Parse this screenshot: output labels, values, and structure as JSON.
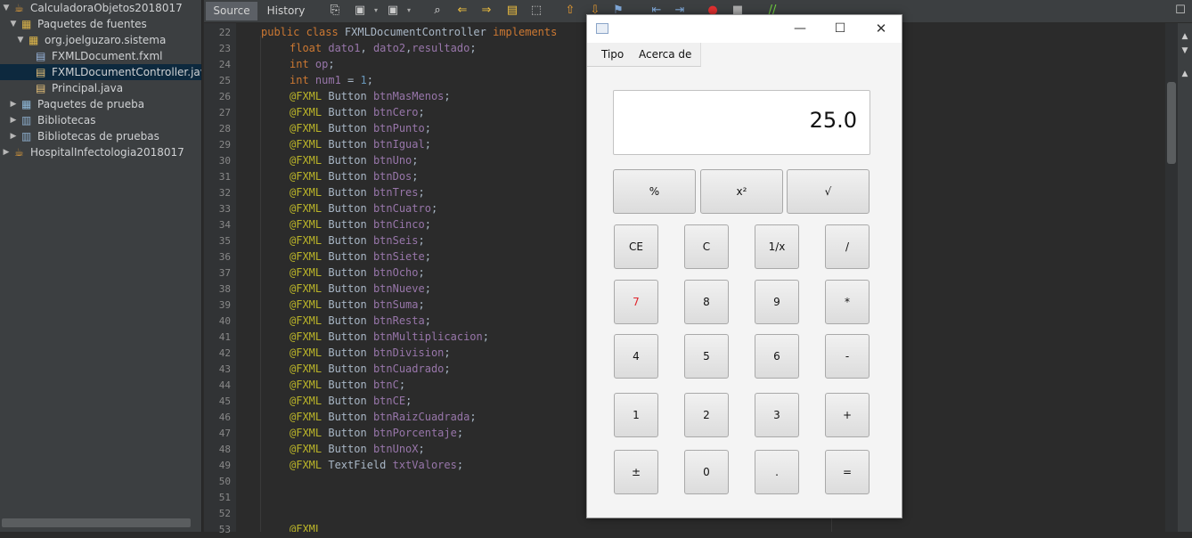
{
  "project": {
    "items": [
      {
        "label": "CalculadoraObjetos2018017",
        "arrow": "▼",
        "icon": "java-project-icon",
        "selected": false
      },
      {
        "label": "Paquetes de fuentes",
        "arrow": "▼",
        "icon": "source-packages-icon",
        "selected": false
      },
      {
        "label": "org.joelguzaro.sistema",
        "arrow": "▼",
        "icon": "package-icon",
        "selected": false
      },
      {
        "label": "FXMLDocument.fxml",
        "arrow": "",
        "icon": "fxml-file-icon",
        "selected": false
      },
      {
        "label": "FXMLDocumentController.jav",
        "arrow": "",
        "icon": "java-file-icon",
        "selected": true
      },
      {
        "label": "Principal.java",
        "arrow": "",
        "icon": "java-file-icon",
        "selected": false
      },
      {
        "label": "Paquetes de prueba",
        "arrow": "▶",
        "icon": "test-packages-icon",
        "selected": false
      },
      {
        "label": "Bibliotecas",
        "arrow": "▶",
        "icon": "libraries-icon",
        "selected": false
      },
      {
        "label": "Bibliotecas de pruebas",
        "arrow": "▶",
        "icon": "libraries-icon",
        "selected": false
      },
      {
        "label": "HospitalInfectologia2018017",
        "arrow": "▶",
        "icon": "java-project-icon",
        "selected": false
      }
    ]
  },
  "toolbar": {
    "source_tab": "Source",
    "history_tab": "History"
  },
  "editor": {
    "lines": [
      {
        "n": "22",
        "tokens": [
          [
            "kw",
            "public class "
          ],
          [
            "",
            "FXMLDocumentController "
          ],
          [
            "kw",
            "implements"
          ]
        ]
      },
      {
        "n": "23",
        "tokens": [
          [
            "kw",
            "float "
          ],
          [
            "field",
            "dato1"
          ],
          [
            "",
            ", "
          ],
          [
            "field",
            "dato2"
          ],
          [
            "",
            ","
          ],
          [
            "field",
            "resultado"
          ],
          [
            "",
            ";"
          ]
        ]
      },
      {
        "n": "24",
        "tokens": [
          [
            "kw",
            "int "
          ],
          [
            "field",
            "op"
          ],
          [
            "",
            ";"
          ]
        ]
      },
      {
        "n": "25",
        "tokens": [
          [
            "kw",
            "int "
          ],
          [
            "field",
            "num1"
          ],
          [
            "",
            " = "
          ],
          [
            "num",
            "1"
          ],
          [
            "",
            ";"
          ]
        ]
      },
      {
        "n": "26",
        "tokens": [
          [
            "ann",
            "@FXML "
          ],
          [
            "",
            "Button "
          ],
          [
            "field",
            "btnMasMenos"
          ],
          [
            "",
            ";"
          ]
        ]
      },
      {
        "n": "27",
        "tokens": [
          [
            "ann",
            "@FXML "
          ],
          [
            "",
            "Button "
          ],
          [
            "field",
            "btnCero"
          ],
          [
            "",
            ";"
          ]
        ]
      },
      {
        "n": "28",
        "tokens": [
          [
            "ann",
            "@FXML "
          ],
          [
            "",
            "Button "
          ],
          [
            "field",
            "btnPunto"
          ],
          [
            "",
            ";"
          ]
        ]
      },
      {
        "n": "29",
        "tokens": [
          [
            "ann",
            "@FXML "
          ],
          [
            "",
            "Button "
          ],
          [
            "field",
            "btnIgual"
          ],
          [
            "",
            ";"
          ]
        ]
      },
      {
        "n": "30",
        "tokens": [
          [
            "ann",
            "@FXML "
          ],
          [
            "",
            "Button "
          ],
          [
            "field",
            "btnUno"
          ],
          [
            "",
            ";"
          ]
        ]
      },
      {
        "n": "31",
        "tokens": [
          [
            "ann",
            "@FXML "
          ],
          [
            "",
            "Button "
          ],
          [
            "field",
            "btnDos"
          ],
          [
            "",
            ";"
          ]
        ]
      },
      {
        "n": "32",
        "tokens": [
          [
            "ann",
            "@FXML "
          ],
          [
            "",
            "Button "
          ],
          [
            "field",
            "btnTres"
          ],
          [
            "",
            ";"
          ]
        ]
      },
      {
        "n": "33",
        "tokens": [
          [
            "ann",
            "@FXML "
          ],
          [
            "",
            "Button "
          ],
          [
            "field",
            "btnCuatro"
          ],
          [
            "",
            ";"
          ]
        ]
      },
      {
        "n": "34",
        "tokens": [
          [
            "ann",
            "@FXML "
          ],
          [
            "",
            "Button "
          ],
          [
            "field",
            "btnCinco"
          ],
          [
            "",
            ";"
          ]
        ]
      },
      {
        "n": "35",
        "tokens": [
          [
            "ann",
            "@FXML "
          ],
          [
            "",
            "Button "
          ],
          [
            "field",
            "btnSeis"
          ],
          [
            "",
            ";"
          ]
        ]
      },
      {
        "n": "36",
        "tokens": [
          [
            "ann",
            "@FXML "
          ],
          [
            "",
            "Button "
          ],
          [
            "field",
            "btnSiete"
          ],
          [
            "",
            ";"
          ]
        ]
      },
      {
        "n": "37",
        "tokens": [
          [
            "ann",
            "@FXML "
          ],
          [
            "",
            "Button "
          ],
          [
            "field",
            "btnOcho"
          ],
          [
            "",
            ";"
          ]
        ]
      },
      {
        "n": "38",
        "tokens": [
          [
            "ann",
            "@FXML "
          ],
          [
            "",
            "Button "
          ],
          [
            "field",
            "btnNueve"
          ],
          [
            "",
            ";"
          ]
        ]
      },
      {
        "n": "39",
        "tokens": [
          [
            "ann",
            "@FXML "
          ],
          [
            "",
            "Button "
          ],
          [
            "field",
            "btnSuma"
          ],
          [
            "",
            ";"
          ]
        ]
      },
      {
        "n": "40",
        "tokens": [
          [
            "ann",
            "@FXML "
          ],
          [
            "",
            "Button "
          ],
          [
            "field",
            "btnResta"
          ],
          [
            "",
            ";"
          ]
        ]
      },
      {
        "n": "41",
        "tokens": [
          [
            "ann",
            "@FXML "
          ],
          [
            "",
            "Button "
          ],
          [
            "field",
            "btnMultiplicacion"
          ],
          [
            "",
            ";"
          ]
        ]
      },
      {
        "n": "42",
        "tokens": [
          [
            "ann",
            "@FXML "
          ],
          [
            "",
            "Button "
          ],
          [
            "field",
            "btnDivision"
          ],
          [
            "",
            ";"
          ]
        ]
      },
      {
        "n": "43",
        "tokens": [
          [
            "ann",
            "@FXML "
          ],
          [
            "",
            "Button "
          ],
          [
            "field",
            "btnCuadrado"
          ],
          [
            "",
            ";"
          ]
        ]
      },
      {
        "n": "44",
        "tokens": [
          [
            "ann",
            "@FXML "
          ],
          [
            "",
            "Button "
          ],
          [
            "field",
            "btnC"
          ],
          [
            "",
            ";"
          ]
        ]
      },
      {
        "n": "45",
        "tokens": [
          [
            "ann",
            "@FXML "
          ],
          [
            "",
            "Button "
          ],
          [
            "field",
            "btnCE"
          ],
          [
            "",
            ";"
          ]
        ]
      },
      {
        "n": "46",
        "tokens": [
          [
            "ann",
            "@FXML "
          ],
          [
            "",
            "Button "
          ],
          [
            "field",
            "btnRaizCuadrada"
          ],
          [
            "",
            ";"
          ]
        ]
      },
      {
        "n": "47",
        "tokens": [
          [
            "ann",
            "@FXML "
          ],
          [
            "",
            "Button "
          ],
          [
            "field",
            "btnPorcentaje"
          ],
          [
            "",
            ";"
          ]
        ]
      },
      {
        "n": "48",
        "tokens": [
          [
            "ann",
            "@FXML "
          ],
          [
            "",
            "Button "
          ],
          [
            "field",
            "btnUnoX"
          ],
          [
            "",
            ";"
          ]
        ]
      },
      {
        "n": "49",
        "tokens": [
          [
            "ann",
            "@FXML "
          ],
          [
            "",
            "TextField "
          ],
          [
            "field",
            "txtValores"
          ],
          [
            "",
            ";"
          ]
        ]
      },
      {
        "n": "50",
        "tokens": []
      },
      {
        "n": "51",
        "tokens": []
      },
      {
        "n": "52",
        "tokens": []
      },
      {
        "n": "53",
        "tokens": [
          [
            "ann",
            "@FXML"
          ]
        ]
      }
    ]
  },
  "calculator": {
    "menu": [
      "Tipo",
      "Acerca de"
    ],
    "display": "25.0",
    "buttons": [
      {
        "label": "%",
        "name": "percent-button",
        "red": false
      },
      {
        "label": "x²",
        "name": "square-button",
        "red": false
      },
      {
        "label": "√",
        "name": "sqrt-button",
        "red": false
      },
      {
        "label": "CE",
        "name": "ce-button",
        "red": false
      },
      {
        "label": "C",
        "name": "c-button",
        "red": false
      },
      {
        "label": "1/x",
        "name": "reciprocal-button",
        "red": false
      },
      {
        "label": "/",
        "name": "divide-button",
        "red": false
      },
      {
        "label": "7",
        "name": "seven-button",
        "red": true
      },
      {
        "label": "8",
        "name": "eight-button",
        "red": false
      },
      {
        "label": "9",
        "name": "nine-button",
        "red": false
      },
      {
        "label": "*",
        "name": "multiply-button",
        "red": false
      },
      {
        "label": "4",
        "name": "four-button",
        "red": false
      },
      {
        "label": "5",
        "name": "five-button",
        "red": false
      },
      {
        "label": "6",
        "name": "six-button",
        "red": false
      },
      {
        "label": "-",
        "name": "subtract-button",
        "red": false
      },
      {
        "label": "1",
        "name": "one-button",
        "red": false
      },
      {
        "label": "2",
        "name": "two-button",
        "red": false
      },
      {
        "label": "3",
        "name": "three-button",
        "red": false
      },
      {
        "label": "+",
        "name": "add-button",
        "red": false
      },
      {
        "label": "±",
        "name": "plus-minus-button",
        "red": false
      },
      {
        "label": "0",
        "name": "zero-button",
        "red": false
      },
      {
        "label": ".",
        "name": "decimal-point-button",
        "red": false
      },
      {
        "label": "=",
        "name": "equals-button",
        "red": false
      }
    ]
  },
  "window_controls": {
    "minimize": "—",
    "maximize": "☐",
    "close": "✕"
  }
}
